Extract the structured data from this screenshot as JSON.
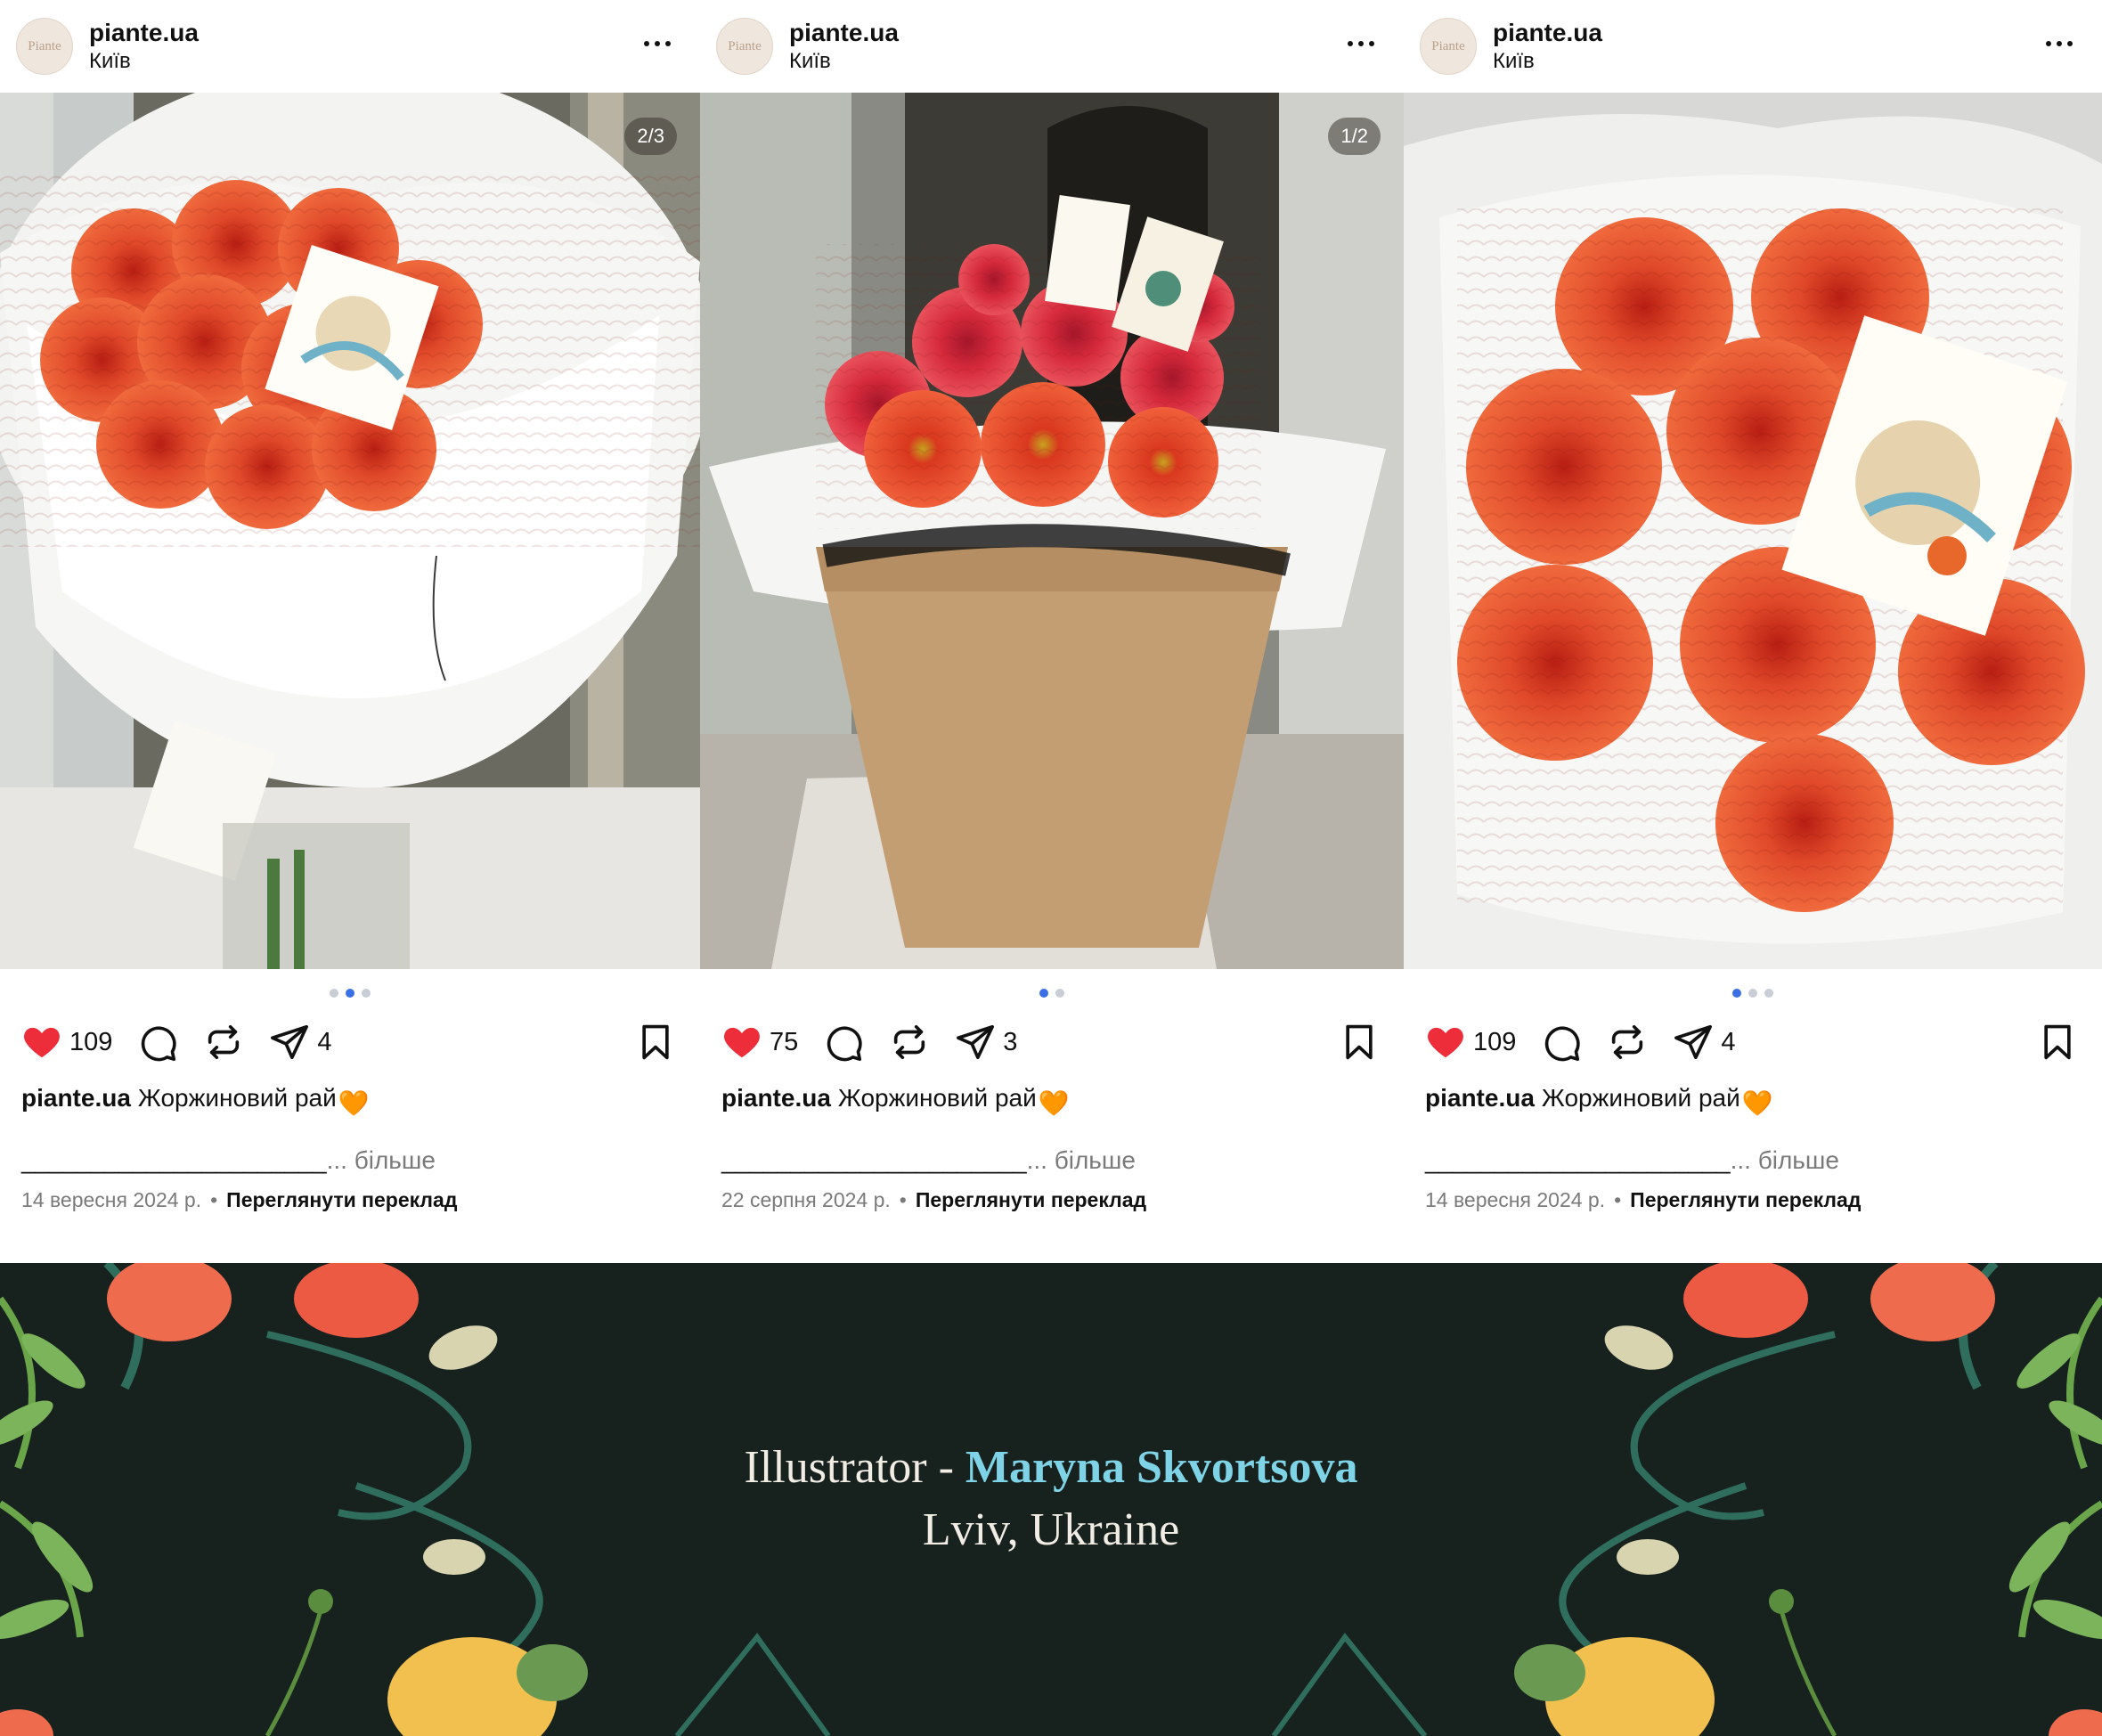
{
  "posts": [
    {
      "username": "piante.ua",
      "location": "Київ",
      "avatar_text": "Piante",
      "image_counter": "2/3",
      "carousel": {
        "count": 3,
        "active_index": 1
      },
      "likes": "109",
      "reposts": "4",
      "caption_user": "piante.ua",
      "caption_text": "Жоржиновий рай",
      "caption_emoji": "🧡",
      "more_underline": "______________________",
      "more_label": "... більше",
      "date": "14 вересня 2024 р.",
      "separator": "•",
      "translate_label": "Переглянути переклад"
    },
    {
      "username": "piante.ua",
      "location": "Київ",
      "avatar_text": "Piante",
      "image_counter": "1/2",
      "carousel": {
        "count": 2,
        "active_index": 0
      },
      "likes": "75",
      "reposts": "3",
      "caption_user": "piante.ua",
      "caption_text": "Жоржиновий рай",
      "caption_emoji": "🧡",
      "more_underline": "______________________",
      "more_label": "... більше",
      "date": "22 серпня 2024 р.",
      "separator": "•",
      "translate_label": "Переглянути переклад"
    },
    {
      "username": "piante.ua",
      "location": "Київ",
      "avatar_text": "Piante",
      "image_counter": "",
      "carousel": {
        "count": 3,
        "active_index": 0
      },
      "likes": "109",
      "reposts": "4",
      "caption_user": "piante.ua",
      "caption_text": "Жоржиновий рай",
      "caption_emoji": "🧡",
      "more_underline": "______________________",
      "more_label": "... більше",
      "date": "14 вересня 2024 р.",
      "separator": "•",
      "translate_label": "Переглянути переклад"
    }
  ],
  "banner": {
    "prefix": "Illustrator - ",
    "name": "Maryna Skvortsova",
    "place": "Lviv, Ukraine"
  },
  "colors": {
    "like_red": "#ed2d3a",
    "active_dot": "#3b6fe4",
    "banner_bg": "#17221f",
    "banner_name": "#7fd3e6",
    "dahlia": "#e2462b"
  },
  "icons": [
    "more-icon",
    "heart-icon",
    "comment-icon",
    "repost-icon",
    "share-icon",
    "bookmark-icon"
  ]
}
